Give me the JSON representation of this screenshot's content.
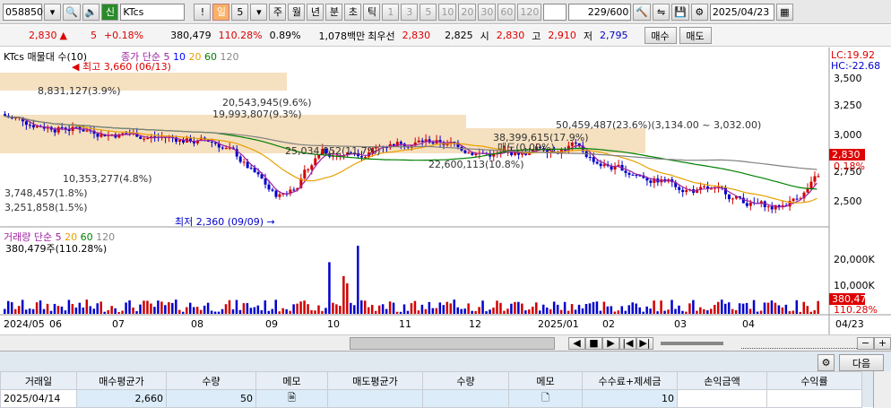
{
  "toolbar": {
    "code": "058850",
    "ticker": "KTcs",
    "periods": [
      "일",
      "5",
      "주",
      "월",
      "년",
      "분",
      "초",
      "틱"
    ],
    "nums": [
      "1",
      "3",
      "5",
      "10",
      "20",
      "30",
      "60",
      "120"
    ],
    "count": "229",
    "total": "/600",
    "date": "2025/04/23",
    "sep_mark": "!"
  },
  "quote": {
    "price": "2,830",
    "change": "5",
    "change_pct": "+0.18%",
    "volume": "380,479",
    "vol_ratio": "110.28%",
    "turnover": "0.89%",
    "amount": "1,078백만",
    "best_ask_label": "최우선",
    "best_ask": "2,830",
    "best_bid": "2,825",
    "open_label": "시",
    "open": "2,830",
    "high_label": "고",
    "high": "2,910",
    "low_label": "저",
    "low": "2,795",
    "buy_label": "매수",
    "sell_label": "매도"
  },
  "chart": {
    "title": "KTcs 매물대 수(10)",
    "ma_label": "종가 단순",
    "ma_periods": [
      "5",
      "10",
      "20",
      "60",
      "120"
    ],
    "high_note": "최고 3,660 (06/13)",
    "low_note": "최저 2,360 (09/09)",
    "lc": "LC:19.92",
    "hc": "HC:-22.68",
    "price_ticks": [
      "3,500",
      "3,250",
      "3,000",
      "2,750",
      "2,500"
    ],
    "cur_price": "2,830",
    "cur_pct": "0.18%",
    "vp": [
      "50,459,487(23.6%)(3,134.00 ~ 3,032.00)",
      "38,399,615(17.9%)",
      "25,034,052(11.7%)",
      "20,543,945(9.6%)",
      "19,993,807(9.3%)",
      "8,831,127(3.9%)",
      "22,600,113(10.8%)",
      "10,353,277(4.8%)",
      "3,748,457(1.8%)",
      "3,251,858(1.5%)"
    ],
    "sell_point": "매도(0.00%)",
    "vol_title": "거래량 단순",
    "vol_ma": [
      "5",
      "20",
      "60",
      "120"
    ],
    "vol_value": "380,479주(110.28%)",
    "vol_ticks": [
      "20,000K",
      "10,000K"
    ],
    "vol_cur": "380,479",
    "vol_pct": "110.28%",
    "months": [
      "2024/05",
      "06",
      "07",
      "08",
      "09",
      "10",
      "11",
      "12",
      "2025/01",
      "02",
      "03",
      "04"
    ],
    "last_date": "04/23",
    "buy_mark": "B"
  },
  "scroll": {
    "controls": [
      "◀",
      "■",
      "▶",
      "|◀",
      "▶|"
    ]
  },
  "grid": {
    "next_label": "다음",
    "headers": [
      "거래일",
      "매수평균가",
      "수량",
      "메모",
      "매도평균가",
      "수량",
      "메모",
      "수수료+제세금",
      "손익금액",
      "수익률"
    ],
    "row": [
      "2025/04/14",
      "2,660",
      "50",
      "",
      "",
      "",
      "",
      "10",
      "",
      ""
    ]
  },
  "colors": {
    "up": "#d00000",
    "down": "#0000cc",
    "ma5": "#a020a0",
    "ma10": "#0000ff",
    "ma20": "#e8a000",
    "ma60": "#008000",
    "ma120": "#808080",
    "vp": "#f5e0c0"
  }
}
